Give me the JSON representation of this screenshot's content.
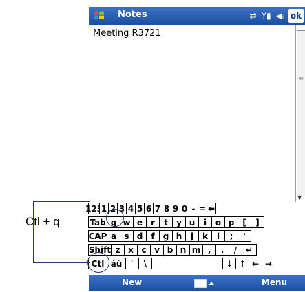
{
  "title_bar": {
    "app_title": "Notes",
    "ok_label": "ok",
    "icons": [
      "windows-start-icon",
      "connectivity-icon",
      "signal-icon",
      "volume-icon"
    ]
  },
  "note": {
    "text": "Meeting R3721"
  },
  "keyboard": {
    "rows": [
      [
        "123",
        "1",
        "2",
        "3",
        "4",
        "5",
        "6",
        "7",
        "8",
        "9",
        "0",
        "-",
        "=",
        "⬅"
      ],
      [
        "Tab",
        "q",
        "w",
        "e",
        "r",
        "t",
        "y",
        "u",
        "i",
        "o",
        "p",
        "[",
        "]"
      ],
      [
        "CAP",
        "a",
        "s",
        "d",
        "f",
        "g",
        "h",
        "j",
        "k",
        "l",
        ";",
        "'"
      ],
      [
        "Shift",
        "z",
        "x",
        "c",
        "v",
        "b",
        "n",
        "m",
        ",",
        ".",
        "/",
        "↵"
      ],
      [
        "Ctl",
        "áü",
        "`",
        "\\",
        "",
        "↓",
        "↑",
        "←",
        "→"
      ]
    ]
  },
  "bottom_bar": {
    "left_softkey": "New",
    "right_softkey": "Menu"
  },
  "annotation": {
    "label": "Ctl + q"
  }
}
